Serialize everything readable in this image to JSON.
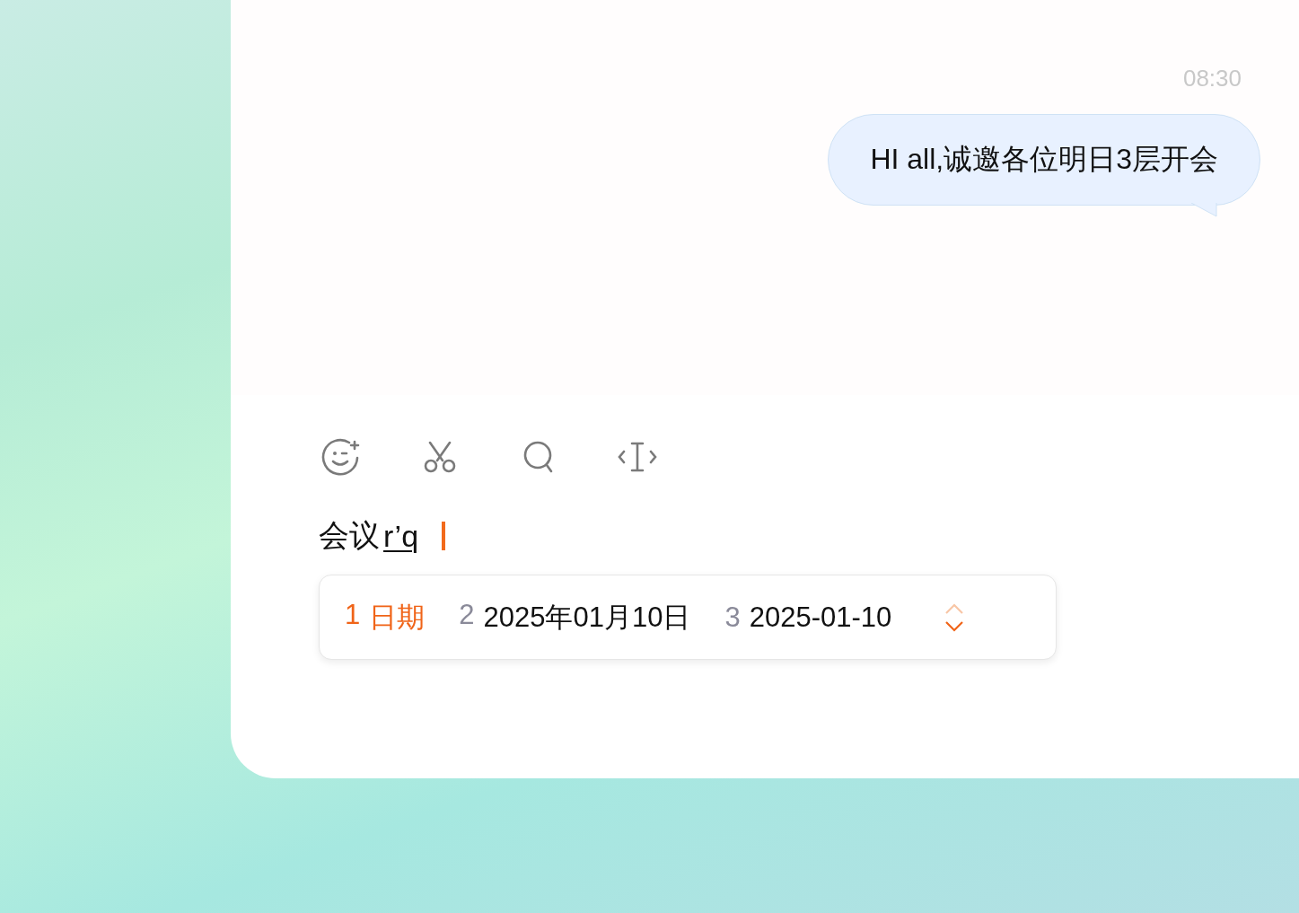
{
  "chat": {
    "messages": [
      {
        "time": "08:30",
        "text": "HI all,诚邀各位明日3层开会",
        "outgoing": true
      }
    ]
  },
  "toolbar": {
    "tools": [
      {
        "kind": "emoji"
      },
      {
        "kind": "cut"
      },
      {
        "kind": "search"
      },
      {
        "kind": "cursor"
      }
    ]
  },
  "input": {
    "text": "会议",
    "composition": "r’q"
  },
  "candidates": {
    "items": [
      {
        "index": "1",
        "text": "日期",
        "selected": true
      },
      {
        "index": "2",
        "text": "2025年01月10日",
        "selected": false
      },
      {
        "index": "3",
        "text": "2025-01-10",
        "selected": false
      }
    ],
    "page_up": {
      "disabled": true
    },
    "page_down": {
      "disabled": false
    }
  }
}
